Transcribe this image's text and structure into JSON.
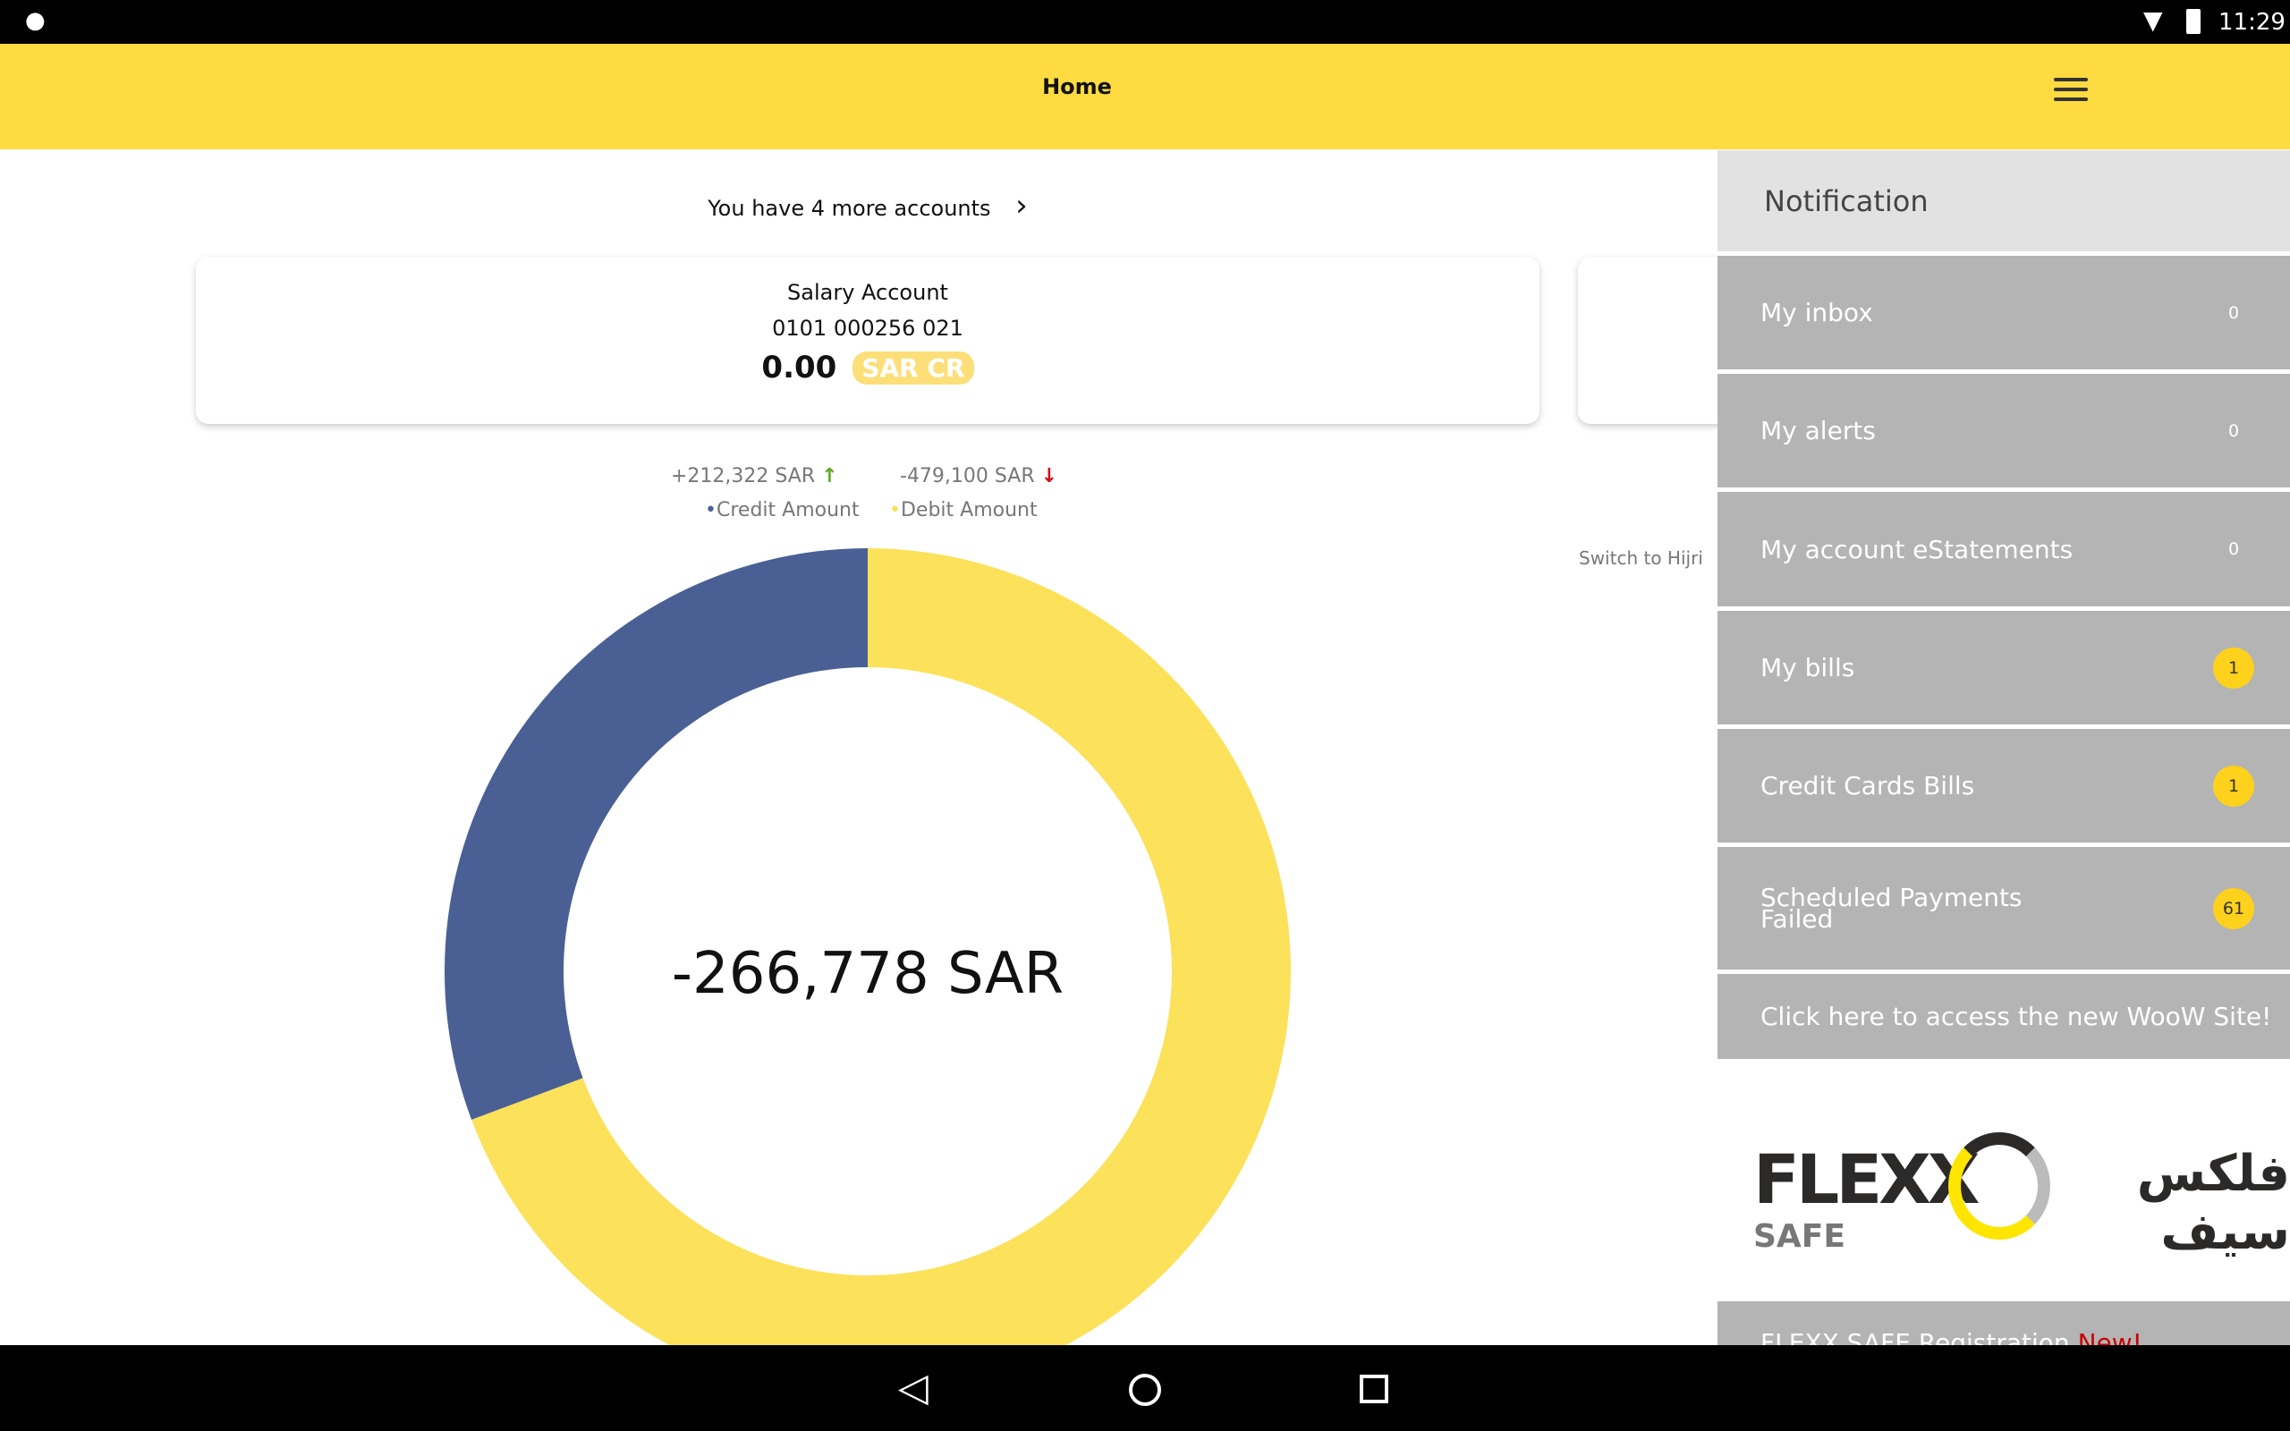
{
  "status_bar": {
    "time": "11:29"
  },
  "header": {
    "title": "Home"
  },
  "accounts": {
    "more_label": "You have 4 more accounts",
    "card": {
      "name": "Salary Account",
      "number": "0101 000256 021",
      "balance": "0.00",
      "currency": "SAR CR"
    }
  },
  "summary": {
    "credit": "+212,322 SAR",
    "debit": "-479,100 SAR",
    "credit_label": "Credit Amount",
    "debit_label": "Debit Amount",
    "net": "-266,778 SAR",
    "switch_label": "Switch to Hijri"
  },
  "chart_data": {
    "type": "pie",
    "donut": true,
    "categories": [
      "Credit Amount",
      "Debit Amount"
    ],
    "values": [
      212322,
      479100
    ],
    "colors": [
      "#4a6094",
      "#fce15a"
    ],
    "center_label": "-266,778 SAR"
  },
  "drawer": {
    "header": "Notification",
    "items": [
      {
        "label": "My inbox",
        "count": "0",
        "highlight": false
      },
      {
        "label": "My alerts",
        "count": "0",
        "highlight": false
      },
      {
        "label": "My account eStatements",
        "count": "0",
        "highlight": false
      },
      {
        "label": "My bills",
        "count": "1",
        "highlight": true
      },
      {
        "label": "Credit Cards Bills",
        "count": "1",
        "highlight": true
      },
      {
        "label": "Scheduled Payments Failed",
        "count": "61",
        "highlight": true
      },
      {
        "label": "Click here to access the new WooW Site!",
        "count": null,
        "highlight": false
      }
    ],
    "logo": {
      "en": "FLEXX",
      "sub": "SAFE",
      "ar": "فلكس سيف"
    },
    "flexx_item": {
      "label": "FLEXX SAFE Registration",
      "badge": "New!"
    }
  }
}
